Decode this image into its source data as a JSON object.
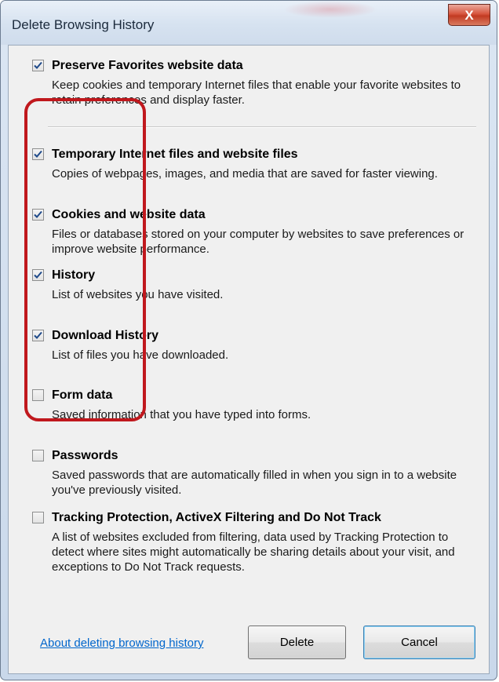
{
  "window": {
    "title": "Delete Browsing History",
    "close_glyph": "X"
  },
  "options": [
    {
      "checked": true,
      "title": "Preserve Favorites website data",
      "description": "Keep cookies and temporary Internet files that enable your favorite websites to retain preferences and display faster."
    },
    {
      "checked": true,
      "title": "Temporary Internet files and website files",
      "description": "Copies of webpages, images, and media that are saved for faster viewing."
    },
    {
      "checked": true,
      "title": "Cookies and website data",
      "description": "Files or databases stored on your computer by websites to save preferences or improve website performance."
    },
    {
      "checked": true,
      "title": "History",
      "description": "List of websites you have visited."
    },
    {
      "checked": true,
      "title": "Download History",
      "description": "List of files you have downloaded."
    },
    {
      "checked": false,
      "title": "Form data",
      "description": "Saved information that you have typed into forms."
    },
    {
      "checked": false,
      "title": "Passwords",
      "description": "Saved passwords that are automatically filled in when you sign in to a website you've previously visited."
    },
    {
      "checked": false,
      "title": "Tracking Protection, ActiveX Filtering and Do Not Track",
      "description": "A list of websites excluded from filtering, data used by Tracking Protection to detect where sites might automatically be sharing details about your visit, and exceptions to Do Not Track requests."
    }
  ],
  "footer": {
    "about_link": "About deleting browsing history",
    "delete_label": "Delete",
    "cancel_label": "Cancel"
  },
  "colors": {
    "highlight": "#c0181d",
    "link": "#0066cc",
    "check": "#1f4a8a"
  }
}
